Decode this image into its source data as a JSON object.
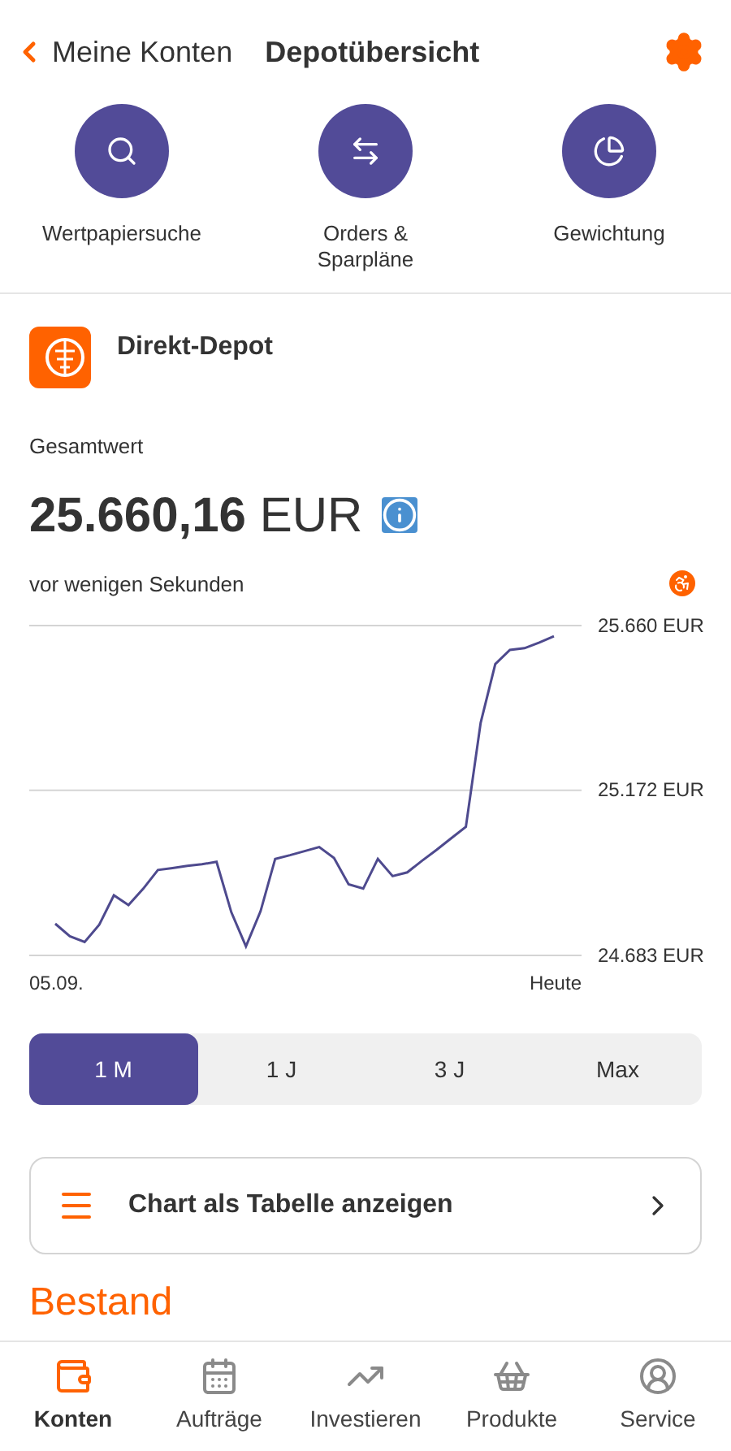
{
  "header": {
    "back_label": "Meine Konten",
    "title": "Depotübersicht"
  },
  "actions": [
    {
      "kind": "search",
      "label": "Wertpapiersuche"
    },
    {
      "kind": "transfer",
      "label": "Orders & Sparpläne"
    },
    {
      "kind": "pie",
      "label": "Gewichtung"
    }
  ],
  "account": {
    "name": "Direkt-Depot",
    "total_label": "Gesamtwert",
    "amount": "25.660,16",
    "currency": "EUR",
    "updated": "vor wenigen Sekunden"
  },
  "chart": {
    "chart_data": {
      "type": "line",
      "categories": [
        "05.09.",
        null,
        null,
        null,
        null,
        null,
        null,
        null,
        null,
        null,
        null,
        null,
        null,
        null,
        null,
        null,
        null,
        null,
        null,
        null,
        null,
        null,
        null,
        null,
        null,
        null,
        null,
        null,
        null,
        null,
        null,
        null,
        null,
        null,
        "Heute"
      ],
      "series": [
        {
          "color": "#4e4a8e",
          "values": [
            24777,
            24740,
            24723,
            24774,
            24861,
            24832,
            24881,
            24936,
            24942,
            24948,
            24953,
            24960,
            24811,
            24710,
            24814,
            24969,
            24980,
            24992,
            25004,
            24972,
            24894,
            24881,
            24969,
            24918,
            24929,
            24963,
            24996,
            25030,
            25064,
            25372,
            25546,
            25588,
            25593,
            25610,
            25628
          ]
        }
      ],
      "ylim": [
        24683,
        25660
      ],
      "yticks": [
        {
          "value": 25660,
          "label": "25.660 EUR"
        },
        {
          "value": 25172,
          "label": "25.172 EUR"
        },
        {
          "value": 24683,
          "label": "24.683 EUR"
        }
      ]
    }
  },
  "ranges": [
    {
      "label": "1 M",
      "selected": true
    },
    {
      "label": "1 J",
      "selected": false
    },
    {
      "label": "3 J",
      "selected": false
    },
    {
      "label": "Max",
      "selected": false
    }
  ],
  "table_button": {
    "label": "Chart als Tabelle anzeigen"
  },
  "section_title": "Bestand",
  "nav": [
    {
      "kind": "wallet",
      "label": "Konten",
      "selected": true
    },
    {
      "kind": "calendar",
      "label": "Aufträge",
      "selected": false
    },
    {
      "kind": "trend",
      "label": "Investieren",
      "selected": false
    },
    {
      "kind": "basket",
      "label": "Produkte",
      "selected": false
    },
    {
      "kind": "person",
      "label": "Service",
      "selected": false
    }
  ]
}
